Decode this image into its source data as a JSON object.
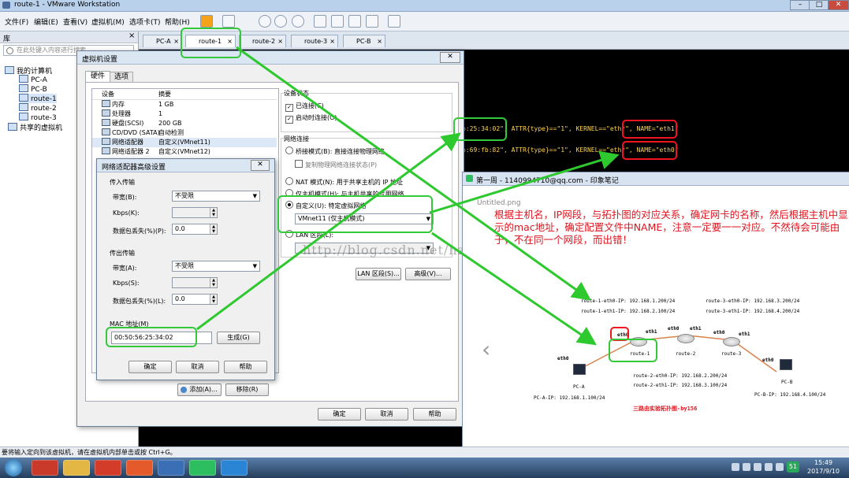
{
  "window": {
    "title": "route-1 - VMware Workstation",
    "minimize": "–",
    "maximize": "□",
    "close": "✕"
  },
  "menu": [
    "文件(F)",
    "编辑(E)",
    "查看(V)",
    "虚拟机(M)",
    "选项卡(T)",
    "帮助(H)"
  ],
  "library": {
    "title": "库",
    "close": "×",
    "search_placeholder": "在此处键入内容进行搜索",
    "tree": [
      "我的计算机",
      "PC-A",
      "PC-B",
      "route-1",
      "route-2",
      "route-3",
      "共享的虚拟机"
    ]
  },
  "tabs": [
    "PC-A",
    "route-1",
    "route-2",
    "route-3",
    "PC-B"
  ],
  "tab_close": "×",
  "console": {
    "line1": "b:25:34:02\", ATTR{type}==\"1\", KERNEL==\"eth*\", NAME=\"eth1\"",
    "line2": "b:69:fb:82\", ATTR{type}==\"1\", KERNEL==\"eth*\", NAME=\"eth0\""
  },
  "vm_settings": {
    "title": "虚拟机设置",
    "close": "✕",
    "tab_hardware": "硬件",
    "tab_options": "选项",
    "col_device": "设备",
    "col_summary": "摘要",
    "devices": [
      {
        "device": "内存",
        "summary": "1 GB"
      },
      {
        "device": "处理器",
        "summary": "1"
      },
      {
        "device": "硬盘(SCSI)",
        "summary": "200 GB"
      },
      {
        "device": "CD/DVD (SATA)",
        "summary": "自动检测"
      },
      {
        "device": "网络适配器",
        "summary": "自定义(VMnet11)"
      },
      {
        "device": "网络适配器 2",
        "summary": "自定义(VMnet12)"
      }
    ],
    "device_status": "设备状态",
    "connected": "已连接(C)",
    "connect_at_power_on": "启动时连接(O)",
    "network_connection": "网络连接",
    "bridged": "桥接模式(B): 直接连接物理网络",
    "replicate": "复制物理网络连接状态(P)",
    "nat": "NAT 模式(N): 用于共享主机的 IP 地址",
    "host_only": "仅主机模式(H): 与主机共享的专用网络",
    "custom": "自定义(U): 特定虚拟网络",
    "vmnet": "VMnet11 (仅主机模式)",
    "lan_segment": "LAN 区段(L):",
    "lan_segments_btn": "LAN 区段(S)...",
    "advanced_btn": "高级(V)...",
    "add_btn": "添加(A)...",
    "remove_btn": "移除(R)",
    "ok": "确定",
    "cancel": "取消",
    "help": "帮助"
  },
  "adapter_advanced": {
    "title": "网络适配器高级设置",
    "close": "✕",
    "incoming": "传入传输",
    "outgoing": "传出传输",
    "bandwidth": "带宽(B):",
    "bandwidth_out": "带宽(A):",
    "bandwidth_value": "不受限",
    "kbps": "Kbps(K):",
    "kbps_out": "Kbps(S):",
    "loss": "数据包丢失(%)(P):",
    "loss_out": "数据包丢失(%)(L):",
    "loss_value": "0.0",
    "mac_label": "MAC 地址(M)",
    "mac_value": "00:50:56:25:34:02",
    "generate": "生成(G)",
    "ok": "确定",
    "cancel": "取消",
    "help": "帮助"
  },
  "watermark": "http://blog.csdn.net/hz156",
  "note": {
    "title": "第一周 - 1140994710@qq.com - 印象笔记",
    "filename": "Untitled.png",
    "annotation": "根据主机名，IP网段，与拓扑图的对应关系，确定网卡的名称，然后根据主机中显示的mac地址，确定配置文件中NAME，注意一定要一一对应。不然待会可能由于，不在同一个网段，而出错！",
    "prev": "‹"
  },
  "topology": {
    "r1_eth0": "route-1-eth0-IP: 192.168.1.200/24",
    "r1_eth1": "route-1-eth1-IP: 192.168.2.100/24",
    "r3_eth0": "route-3-eth0-IP: 192.168.3.200/24",
    "r3_eth1": "route-3-eth1-IP: 192.168.4.200/24",
    "r2_eth0": "route-2-eth0-IP: 192.168.2.200/24",
    "r2_eth1": "route-2-eth1-IP: 192.168.3.100/24",
    "pca_ip": "PC-A-IP: 192.168.1.100/24",
    "pcb_ip": "PC-B-IP: 192.168.4.100/24",
    "eth0": "eth0",
    "eth1": "eth1",
    "route1": "route-1",
    "route2": "route-2",
    "route3": "route-3",
    "pca": "PC-A",
    "pcb": "PC-B",
    "caption": "三路由实验拓扑图-by156"
  },
  "statusbar": "要将输入定向到该虚拟机，请在虚拟机内部单击或按 Ctrl+G。",
  "tray": {
    "time": "15:49",
    "date": "2017/9/10",
    "badge": "51"
  }
}
